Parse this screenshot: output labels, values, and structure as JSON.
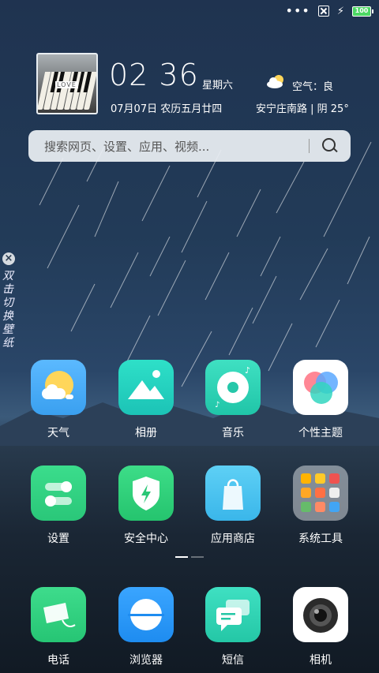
{
  "status_bar": {
    "more_dots": "•••",
    "battery_level": "100",
    "colors": {
      "battery": "#4cd964"
    }
  },
  "clock_widget": {
    "album_text": "LOVE",
    "time": "02 36",
    "weekday": "星期六",
    "date": "07月07日  农历五月廿四",
    "weather_icon": "partly-cloudy-icon",
    "air_quality": "空气：良",
    "location_weather": "安宁庄南路 | 阴 25°"
  },
  "search": {
    "placeholder": "搜索网页、设置、应用、视频..."
  },
  "side_panel": {
    "close": "×",
    "text": "双击切换壁纸"
  },
  "apps": [
    {
      "label": "天气",
      "icon": "weather-icon"
    },
    {
      "label": "相册",
      "icon": "gallery-icon"
    },
    {
      "label": "音乐",
      "icon": "music-icon"
    },
    {
      "label": "个性主题",
      "icon": "themes-icon"
    },
    {
      "label": "设置",
      "icon": "settings-icon"
    },
    {
      "label": "安全中心",
      "icon": "security-icon"
    },
    {
      "label": "应用商店",
      "icon": "app-store-icon"
    },
    {
      "label": "系统工具",
      "icon": "system-tools-folder-icon"
    }
  ],
  "dock": [
    {
      "label": "电话",
      "icon": "phone-icon"
    },
    {
      "label": "浏览器",
      "icon": "browser-icon"
    },
    {
      "label": "短信",
      "icon": "messages-icon"
    },
    {
      "label": "相机",
      "icon": "camera-icon"
    }
  ],
  "page_indicator": {
    "pages": 2,
    "current": 1
  }
}
